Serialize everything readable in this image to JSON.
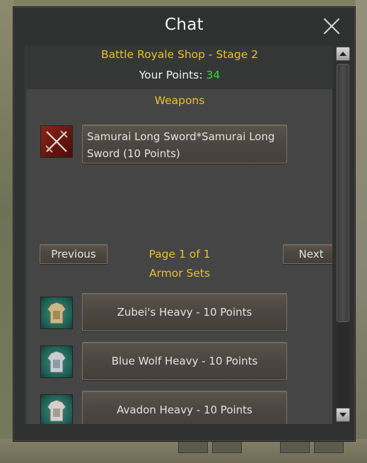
{
  "window": {
    "title": "Chat"
  },
  "shop": {
    "title": "Battle Royale Shop - Stage 2",
    "points_label": "Your Points:",
    "points_value": "34",
    "weapons_heading": "Weapons",
    "weapons": [
      {
        "label": "Samurai Long Sword*Samurai Long Sword (10 Points)",
        "icon": "crossed-swords-icon"
      }
    ],
    "pagination": {
      "previous_label": "Previous",
      "page_label": "Page 1 of 1",
      "next_label": "Next"
    },
    "armor_heading": "Armor Sets",
    "armor": [
      {
        "label": "Zubei's Heavy - 10 Points",
        "icon": "armor-icon"
      },
      {
        "label": "Blue Wolf Heavy - 10 Points",
        "icon": "armor-icon"
      },
      {
        "label": "Avadon Heavy - 10 Points",
        "icon": "armor-icon"
      }
    ]
  },
  "colors": {
    "gold_text": "#e7c22b",
    "points_green": "#2fdc2f",
    "window_bg": "#2f3030",
    "panel_bg": "#454545"
  }
}
